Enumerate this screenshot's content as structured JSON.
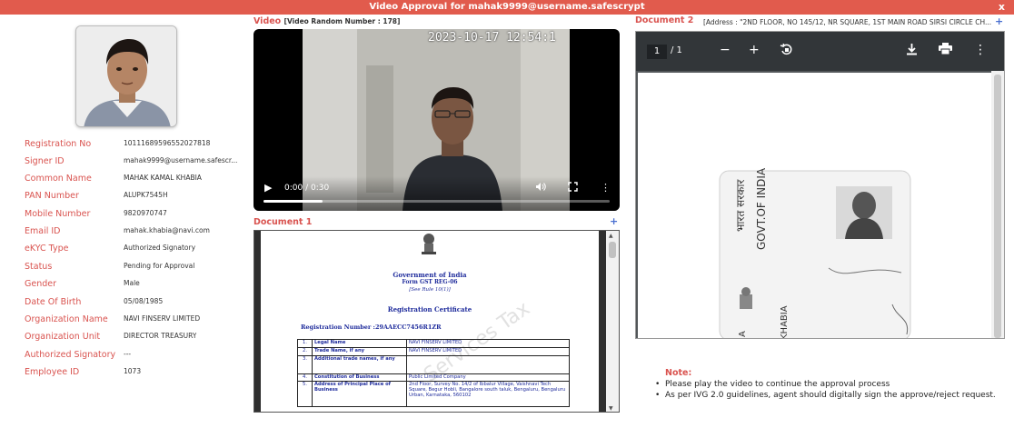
{
  "window": {
    "title": "Video Approval for mahak9999@username.safescrypt",
    "close_label": "x"
  },
  "profile": {
    "fields": [
      {
        "label": "Registration No",
        "value": "10111689596552027818"
      },
      {
        "label": "Signer ID",
        "value": "mahak9999@username.safescr..."
      },
      {
        "label": "Common Name",
        "value": "MAHAK KAMAL KHABIA"
      },
      {
        "label": "PAN Number",
        "value": "ALUPK7545H"
      },
      {
        "label": "Mobile Number",
        "value": "9820970747"
      },
      {
        "label": "Email ID",
        "value": "mahak.khabia@navi.com"
      },
      {
        "label": "eKYC Type",
        "value": "Authorized Signatory"
      },
      {
        "label": "Status",
        "value": "Pending for Approval"
      },
      {
        "label": "Gender",
        "value": "Male"
      },
      {
        "label": "Date Of Birth",
        "value": "05/08/1985"
      },
      {
        "label": "Organization Name",
        "value": "NAVI FINSERV LIMITED"
      },
      {
        "label": "Organization Unit",
        "value": "DIRECTOR TREASURY"
      },
      {
        "label": "Authorized Signatory",
        "value": "---"
      },
      {
        "label": "Employee ID",
        "value": "1073"
      }
    ]
  },
  "video": {
    "title": "Video",
    "random_number": "[Video Random Number : 178]",
    "timestamp": "2023-10-17 12:54:1",
    "time_display": "0:00 / 0:30",
    "progress": 0.17
  },
  "document1": {
    "title": "Document 1",
    "plus": "+",
    "heading1": "Government of India",
    "heading2": "Form GST REG-06",
    "heading3": "[See Rule 10(1)]",
    "heading4": "Registration Certificate",
    "reg_line": "Registration Number :29AAECC7456R1ZR",
    "watermark": "Services Tax",
    "rows": [
      {
        "n": "1.",
        "label": "Legal Name",
        "value": "NAVI FINSERV LIMITED"
      },
      {
        "n": "2.",
        "label": "Trade Name, if any",
        "value": "NAVI FINSERV LIMITED"
      },
      {
        "n": "3.",
        "label": "Additional trade names, if any",
        "value": ""
      },
      {
        "n": "4.",
        "label": "Constitution of Business",
        "value": "Public Limited Company"
      },
      {
        "n": "5.",
        "label": "Address of Principal Place of Business",
        "value": "2nd Floor, Survey No. 14/2 of Ibbalur Village, Vaishnavi Tech Square, Begur Hobli, Bangalore south taluk, Bengaluru, Bengaluru Urban, Karnataka, 560102"
      }
    ]
  },
  "document2": {
    "title": "Document 2",
    "address": "[Address : \"2ND FLOOR, NO 145/12, NR SQUARE, 1ST MAIN ROAD SIRSI CIRCLE CH...",
    "plus": "+",
    "page_current": "1",
    "page_total": "/  1",
    "card_text_hindi": "भारत सरकार",
    "card_text_english": "GOVT.OF INDIA",
    "card_name_fragment": "KHABIA",
    "card_name_fragment2": "IA"
  },
  "note": {
    "title": "Note:",
    "items": [
      "Please play the video to continue the approval process",
      "As per IVG 2.0 guidelines, agent should digitally sign the approve/reject request."
    ]
  }
}
